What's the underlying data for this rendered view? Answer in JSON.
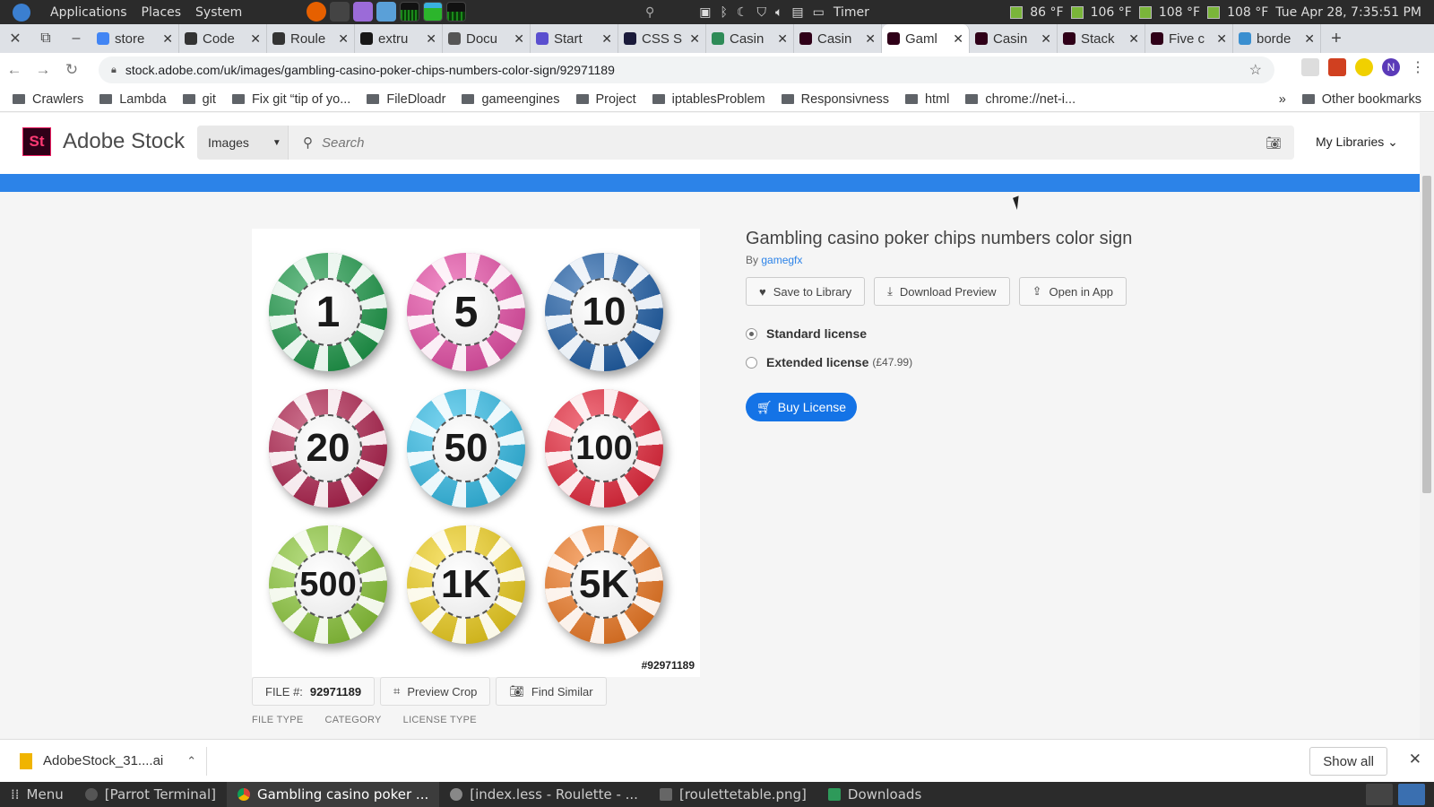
{
  "os": {
    "menu": [
      "Applications",
      "Places",
      "System"
    ],
    "timer_label": "Timer",
    "temps": [
      "86 °F",
      "106 °F",
      "108 °F",
      "108 °F"
    ],
    "clock": "Tue Apr 28, 7:35:51 PM"
  },
  "tabs": [
    {
      "title": "store",
      "color": "#4285f4"
    },
    {
      "title": "Code",
      "color": "#333333"
    },
    {
      "title": "Roule",
      "color": "#333333"
    },
    {
      "title": "extru",
      "color": "#181717"
    },
    {
      "title": "Docu",
      "color": "#555555"
    },
    {
      "title": "Start",
      "color": "#5a4fcf"
    },
    {
      "title": "CSS S",
      "color": "#1a1a3a"
    },
    {
      "title": "Casin",
      "color": "#2e8b57"
    },
    {
      "title": "Casin",
      "color": "#2f0018"
    },
    {
      "title": "Gaml",
      "color": "#2f0018",
      "active": true
    },
    {
      "title": "Casin",
      "color": "#2f0018"
    },
    {
      "title": "Stack",
      "color": "#2f0018"
    },
    {
      "title": "Five c",
      "color": "#2f0018"
    },
    {
      "title": "borde",
      "color": "#3a8fd0"
    }
  ],
  "url": "stock.adobe.com/uk/images/gambling-casino-poker-chips-numbers-color-sign/92971189",
  "bookmarks": [
    "Crawlers",
    "Lambda",
    "git",
    "Fix git “tip of yo...",
    "FileDloadr",
    "gameengines",
    "Project",
    "iptablesProblem",
    "Responsivness",
    "html",
    "chrome://net-i..."
  ],
  "bookmarks_more": "»",
  "other_bookmarks": "Other bookmarks",
  "site": {
    "logo": "St",
    "name": "Adobe Stock",
    "search_type": "Images",
    "search_placeholder": "Search",
    "my_libraries": "My Libraries"
  },
  "asset": {
    "title": "Gambling casino poker chips numbers color sign",
    "by_label": "By",
    "author": "gamegfx",
    "id_label": "#92971189",
    "actions": [
      "Save to Library",
      "Download Preview",
      "Open in App"
    ],
    "licenses": [
      {
        "label": "Standard license",
        "price": "",
        "selected": true
      },
      {
        "label": "Extended license",
        "price": "(£47.99)",
        "selected": false
      }
    ],
    "buy": "Buy License",
    "file_label": "FILE #:",
    "file_num": "92971189",
    "preview_crop": "Preview Crop",
    "find_similar": "Find Similar",
    "meta_headers": [
      "FILE TYPE",
      "CATEGORY",
      "LICENSE TYPE"
    ]
  },
  "chips": [
    {
      "label": "1",
      "color": "#1e9a4a"
    },
    {
      "label": "5",
      "color": "#e84fa8"
    },
    {
      "label": "10",
      "color": "#1f5fa8"
    },
    {
      "label": "20",
      "color": "#b0224e"
    },
    {
      "label": "50",
      "color": "#32bde8"
    },
    {
      "label": "100",
      "color": "#e8283c"
    },
    {
      "label": "500",
      "color": "#8cc83a"
    },
    {
      "label": "1K",
      "color": "#f0d01e"
    },
    {
      "label": "5K",
      "color": "#f07a24"
    }
  ],
  "download": {
    "file": "AdobeStock_31....ai",
    "show_all": "Show all"
  },
  "taskbar": [
    {
      "label": "Menu"
    },
    {
      "label": "[Parrot Terminal]"
    },
    {
      "label": "Gambling casino poker ...",
      "active": true
    },
    {
      "label": "[index.less - Roulette - ..."
    },
    {
      "label": "[roulettetable.png]"
    },
    {
      "label": "Downloads"
    }
  ]
}
